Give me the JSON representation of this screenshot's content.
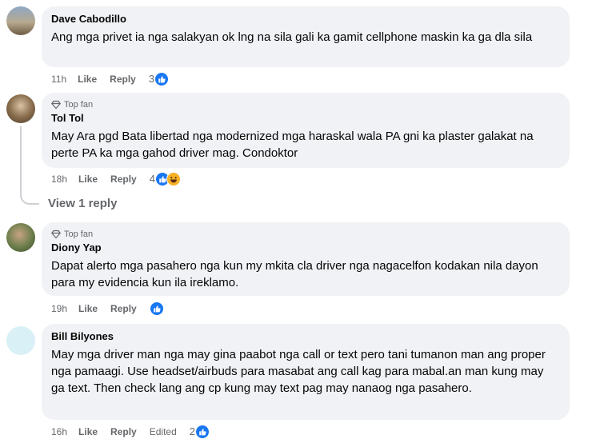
{
  "comments": [
    {
      "name": "Dave Cabodillo",
      "top_fan": "",
      "text": "Ang mga privet ia nga salakyan ok lng na sila gali ka gamit cellphone maskin ka ga dla sila",
      "time": "11h",
      "like": "Like",
      "reply": "Reply",
      "edited": "",
      "reactions": "3",
      "reaction_icons": [
        "like-icon"
      ]
    },
    {
      "name": "Tol Tol",
      "top_fan": "Top fan",
      "text": "May Ara pgd Bata libertad nga modernized mga haraskal wala PA gni ka plaster galakat na perte PA ka mga gahod driver mag. Condoktor",
      "time": "18h",
      "like": "Like",
      "reply": "Reply",
      "edited": "",
      "reactions": "4",
      "reaction_icons": [
        "like-icon",
        "haha-icon"
      ]
    },
    {
      "name": "Diony Yap",
      "top_fan": "Top fan",
      "text": "Dapat alerto mga pasahero nga kun my mkita cla driver nga nagacelfon kodakan nila dayon para my evidencia kun ila ireklamo.",
      "time": "19h",
      "like": "Like",
      "reply": "Reply",
      "edited": "",
      "reactions": "",
      "reaction_icons": [
        "like-icon"
      ]
    },
    {
      "name": "Bill Bilyones",
      "top_fan": "",
      "text": "May mga driver man nga may gina paabot nga call or text pero tani tumanon man ang proper nga pamaagi. Use headset/airbuds para masabat ang call kag para mabal.an man kung may ga text. Then check lang ang cp kung may text pag may nanaog nga pasahero.",
      "time": "16h",
      "like": "Like",
      "reply": "Reply",
      "edited": "Edited",
      "reactions": "2",
      "reaction_icons": [
        "like-icon"
      ]
    }
  ],
  "view_reply": "View 1 reply",
  "colors": {
    "bubble": "#f0f2f5",
    "like_blue": "#1877f2",
    "meta_gray": "#65676b"
  }
}
